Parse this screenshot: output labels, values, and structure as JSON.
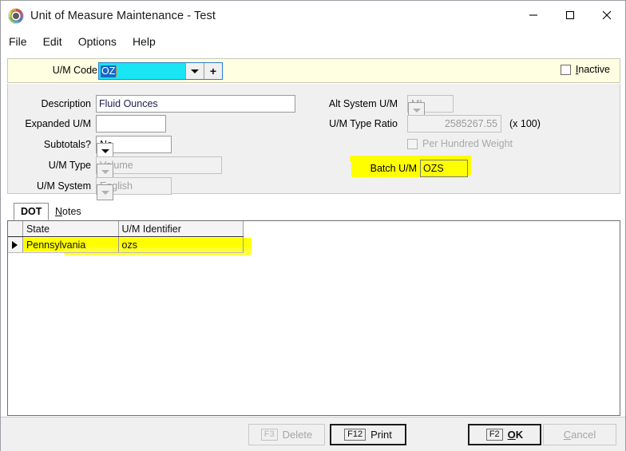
{
  "window": {
    "title": "Unit of Measure Maintenance - Test",
    "icon": "app-gear-icon",
    "controls": {
      "minimize": "minimize-icon",
      "maximize": "maximize-icon",
      "close": "close-icon"
    }
  },
  "menu": {
    "items": [
      "File",
      "Edit",
      "Options",
      "Help"
    ]
  },
  "header": {
    "um_code_label": "U/M Code",
    "um_code_value": "OZ",
    "dropdown_icon": "chevron-down-icon",
    "add_icon": "plus-icon",
    "inactive_label_prefix": "I",
    "inactive_label_rest": "nactive",
    "inactive_checked": false
  },
  "form": {
    "description_label": "Description",
    "description_value": "Fluid Ounces",
    "expanded_um_label": "Expanded U/M",
    "expanded_um_value": "",
    "subtotals_label": "Subtotals?",
    "subtotals_value": "No",
    "um_type_label": "U/M Type",
    "um_type_value": "Volume",
    "um_system_label": "U/M System",
    "um_system_value": "English",
    "alt_system_um_label": "Alt System U/M",
    "alt_system_um_value": "ML",
    "um_type_ratio_label": "U/M Type Ratio",
    "um_type_ratio_value": "2585267.55",
    "um_type_ratio_suffix": "(x 100)",
    "per_hundred_weight_label": "Per Hundred Weight",
    "per_hundred_weight_checked": false,
    "batch_um_label": "Batch U/M",
    "batch_um_value": "OZS"
  },
  "tabs": {
    "active": "DOT",
    "items": [
      {
        "label": "DOT",
        "active": true
      },
      {
        "label_prefix": "N",
        "label_rest": "otes",
        "label": "Notes",
        "active": false
      }
    ]
  },
  "grid": {
    "columns": [
      "State",
      "U/M Identifier"
    ],
    "rows": [
      {
        "selected": true,
        "state": "Pennsylvania",
        "identifier": "ozs"
      }
    ]
  },
  "buttons": {
    "delete": {
      "fkey": "F3",
      "label": "Delete",
      "enabled": false
    },
    "print": {
      "fkey": "F12",
      "label": "Print",
      "enabled": true
    },
    "ok": {
      "fkey": "F2",
      "label_prefix": "O",
      "label_rest": "K",
      "label": "OK",
      "enabled": true
    },
    "cancel": {
      "label_prefix": "C",
      "label_rest": "ancel",
      "label": "Cancel",
      "enabled": false
    }
  },
  "colors": {
    "header_band": "#FFFFE1",
    "panel": "#F0F0F0",
    "combo_active": "#19E5F5",
    "selection": "#1668C4",
    "highlighter": "#FFFF00"
  }
}
